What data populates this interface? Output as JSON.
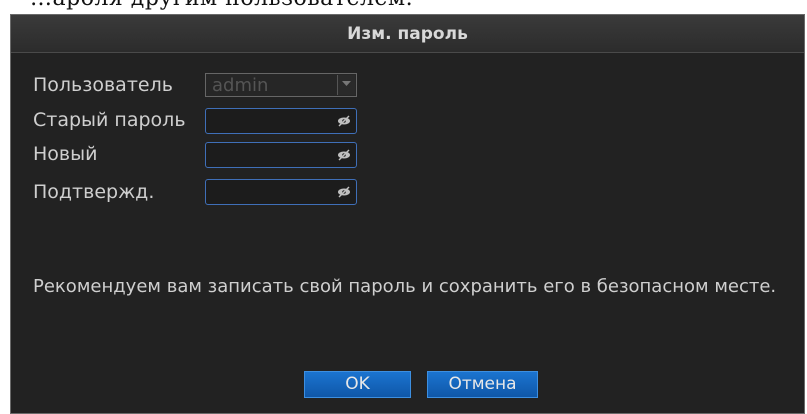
{
  "top_crop_text": "…ароля другим пользователем.",
  "dialog": {
    "title": "Изм. пароль",
    "fields": [
      {
        "label": "Пользователь",
        "value": "admin",
        "type": "select"
      },
      {
        "label": "Старый пароль",
        "value": "",
        "type": "password"
      },
      {
        "label": "Новый",
        "value": "",
        "type": "password"
      },
      {
        "label": "Подтвержд.",
        "value": "",
        "type": "password"
      }
    ],
    "note": "Рекомендуем вам записать свой пароль и сохранить его в безопасном месте.",
    "buttons": {
      "ok": "OK",
      "cancel": "Отмена"
    }
  },
  "icons": {
    "password_toggle": "eye-hidden-icon",
    "dropdown": "chevron-down-icon"
  },
  "colors": {
    "panel_bg": "#222222",
    "field_border": "#3f6fb8",
    "button_bg": "#1565c0"
  }
}
